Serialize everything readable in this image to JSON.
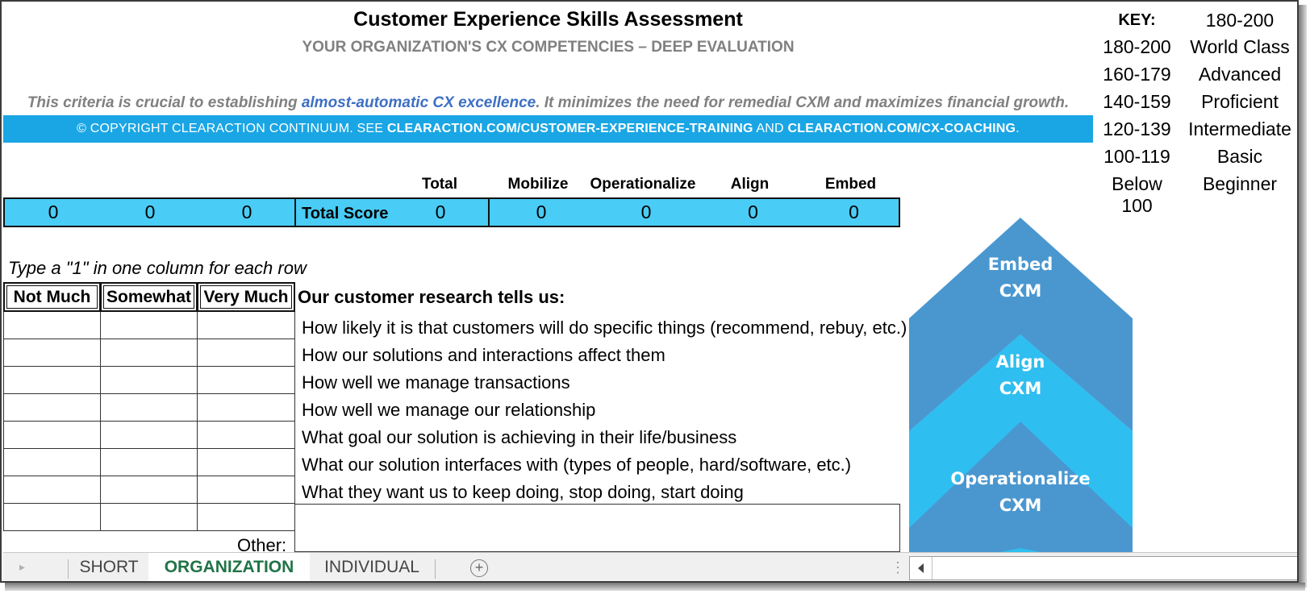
{
  "header": {
    "title": "Customer Experience Skills Assessment",
    "subtitle": "YOUR ORGANIZATION'S CX COMPETENCIES – DEEP EVALUATION",
    "criteria_before": "This criteria is crucial to establishing ",
    "criteria_emphasis": "almost-automatic CX excellence",
    "criteria_after": ". It minimizes the need for remedial CXM and maximizes financial growth.",
    "copyright_a": "© COPYRIGHT CLEARACTION CONTINUUM. SEE ",
    "copyright_link1": "CLEARACTION.COM/CUSTOMER-EXPERIENCE-TRAINING",
    "copyright_mid": " AND ",
    "copyright_link2": "CLEARACTION.COM/CX-COACHING",
    "copyright_end": "."
  },
  "key": {
    "label": "KEY:",
    "top_value": "180-200",
    "rows": [
      {
        "range": "180-200",
        "level": "World Class"
      },
      {
        "range": "160-179",
        "level": "Advanced"
      },
      {
        "range": "140-159",
        "level": "Proficient"
      },
      {
        "range": "120-139",
        "level": "Intermediate"
      },
      {
        "range": "100-119",
        "level": "Basic"
      },
      {
        "range": "Below 100",
        "level": "Beginner"
      }
    ]
  },
  "scores": {
    "headers": {
      "total": "Total",
      "mobilize": "Mobilize",
      "operationalize": "Operationalize",
      "align": "Align",
      "embed": "Embed"
    },
    "left_values": [
      "0",
      "0",
      "0"
    ],
    "label": "Total Score",
    "total": "0",
    "mobilize": "0",
    "operationalize": "0",
    "align": "0",
    "embed": "0"
  },
  "instruction": "Type a \"1\" in one column for each row",
  "columns": [
    "Not Much",
    "Somewhat",
    "Very Much"
  ],
  "questions": {
    "heading": "Our customer research tells us:",
    "items": [
      "How likely it is that customers will do specific things (recommend, rebuy, etc.)",
      "How our solutions and interactions affect them",
      "How well we manage transactions",
      "How well we manage our relationship",
      "What goal our solution is achieving in their life/business",
      "What our solution interfaces with (types of people, hard/software, etc.)",
      "What they want us to keep doing, stop doing, start doing"
    ],
    "other_label": "Other:"
  },
  "chevrons": {
    "embed_1": "Embed",
    "embed_2": "CXM",
    "align_1": "Align",
    "align_2": "CXM",
    "oper_1": "Operationalize",
    "oper_2": "CXM",
    "colors": {
      "dark": "#4a97d0",
      "light": "#2fbef0"
    }
  },
  "tabs": {
    "items": [
      "SHORT",
      "ORGANIZATION",
      "INDIVIDUAL"
    ],
    "active": "ORGANIZATION"
  }
}
